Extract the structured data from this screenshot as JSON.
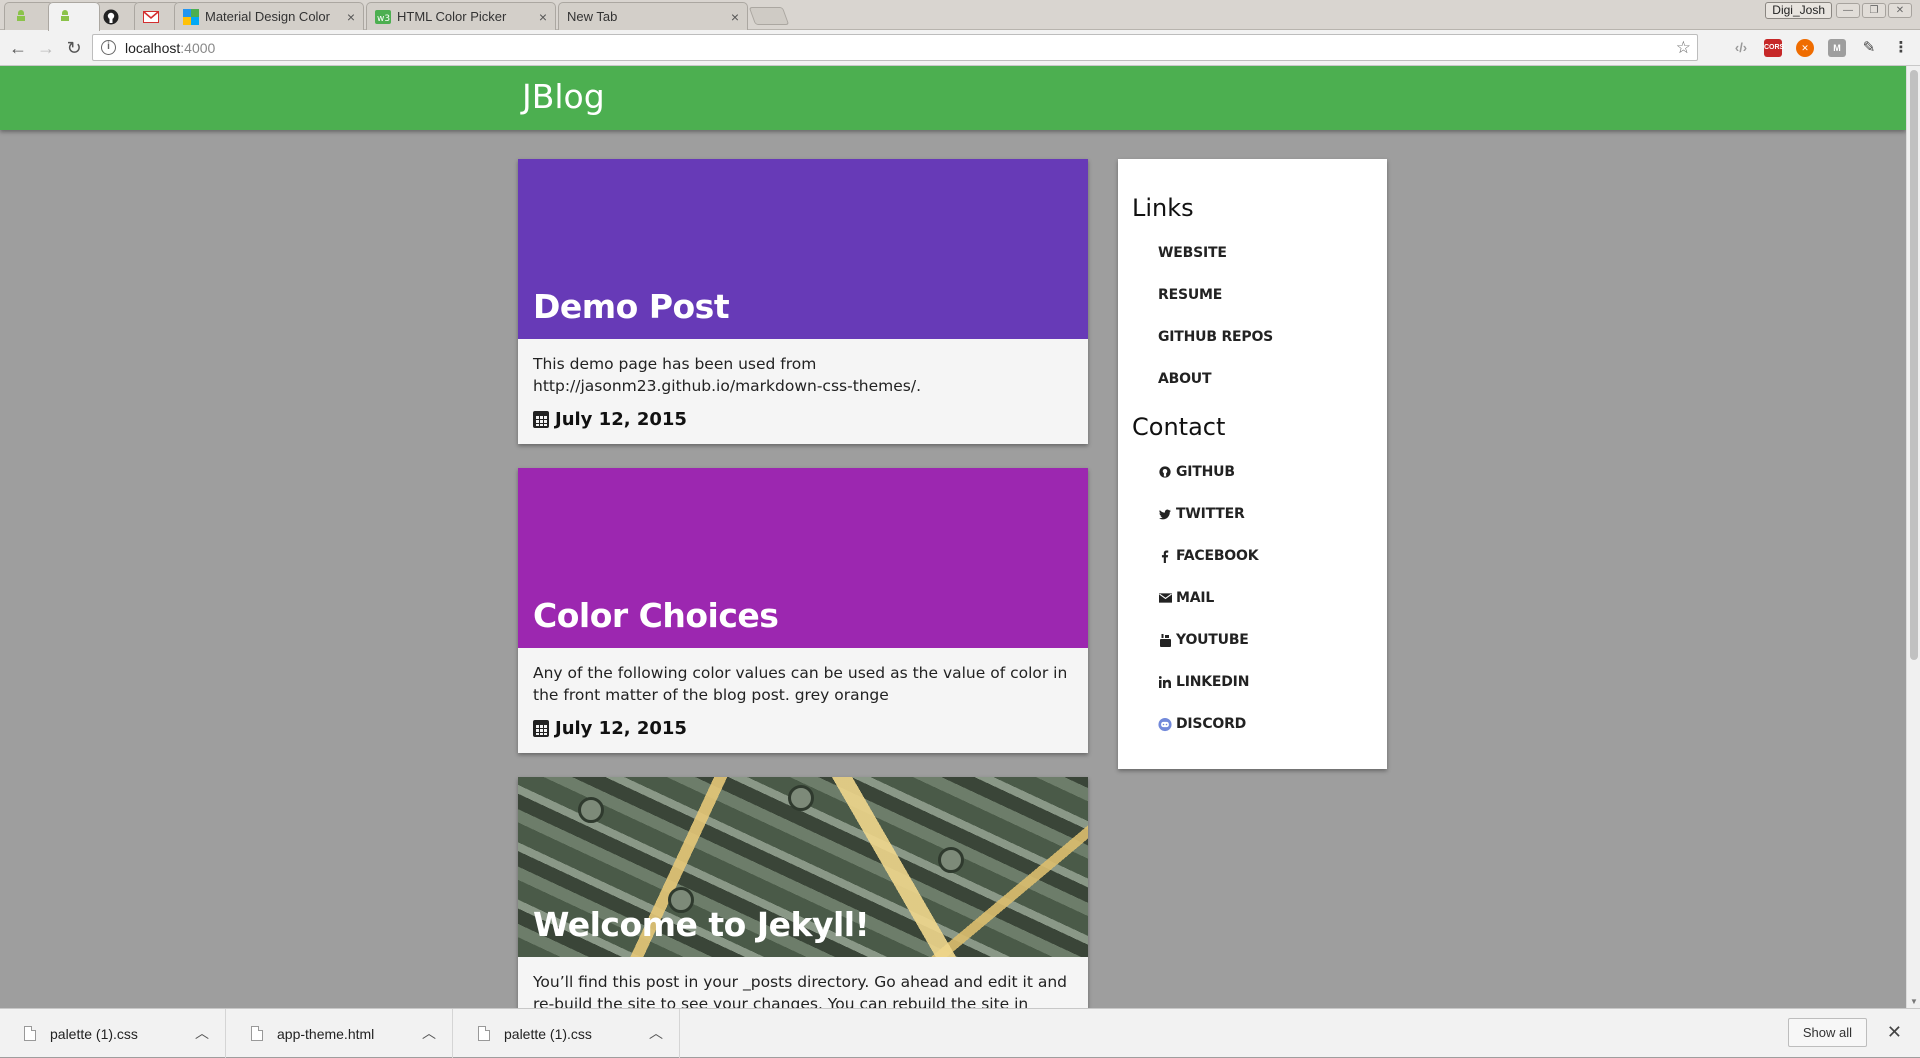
{
  "browser": {
    "tabs": [
      {
        "label": "",
        "icon": "android-icon"
      },
      {
        "label": "",
        "icon": "android-icon"
      },
      {
        "label": "",
        "icon": "github-icon"
      },
      {
        "label": "",
        "icon": "gmail-icon"
      },
      {
        "label": "Material Design Color",
        "icon": "material-icon"
      },
      {
        "label": "HTML Color Picker",
        "icon": "w3-icon"
      },
      {
        "label": "New Tab",
        "icon": ""
      }
    ],
    "profile": "Digi_Josh",
    "url_host": "localhost",
    "url_port": ":4000",
    "extensions": [
      "code-icon",
      "cors-icon",
      "extension-icon",
      "m-icon",
      "eyedropper-icon"
    ]
  },
  "site": {
    "brand": "JBlog",
    "brand_color": "#4caf50"
  },
  "posts": [
    {
      "title": "Demo Post",
      "color": "#673ab7",
      "excerpt": "This demo page has been used from http://jasonm23.github.io/markdown-css-themes/.",
      "date": "July 12, 2015"
    },
    {
      "title": "Color Choices",
      "color": "#9c27b0",
      "excerpt": "Any of the following color values can be used as the value of color in the front matter of the blog post. grey orange",
      "date": "July 12, 2015"
    },
    {
      "title": "Welcome to Jekyll!",
      "color": "image",
      "excerpt": "You’ll find this post in your _posts directory. Go ahead and edit it and re-build the site to see your changes. You can rebuild the site in many different ways",
      "date": ""
    }
  ],
  "sidebar": {
    "links_heading": "Links",
    "links": [
      "Website",
      "Resume",
      "Github Repos",
      "About"
    ],
    "contact_heading": "Contact",
    "contact": [
      {
        "label": "Github",
        "icon": "github-icon"
      },
      {
        "label": "Twitter",
        "icon": "twitter-icon"
      },
      {
        "label": "Facebook",
        "icon": "facebook-icon"
      },
      {
        "label": "Mail",
        "icon": "mail-icon"
      },
      {
        "label": "Youtube",
        "icon": "youtube-icon"
      },
      {
        "label": "LinkedIn",
        "icon": "linkedin-icon"
      },
      {
        "label": "Discord",
        "icon": "discord-icon"
      }
    ]
  },
  "downloads": {
    "items": [
      "palette (1).css",
      "app-theme.html",
      "palette (1).css"
    ],
    "show_all": "Show all"
  }
}
